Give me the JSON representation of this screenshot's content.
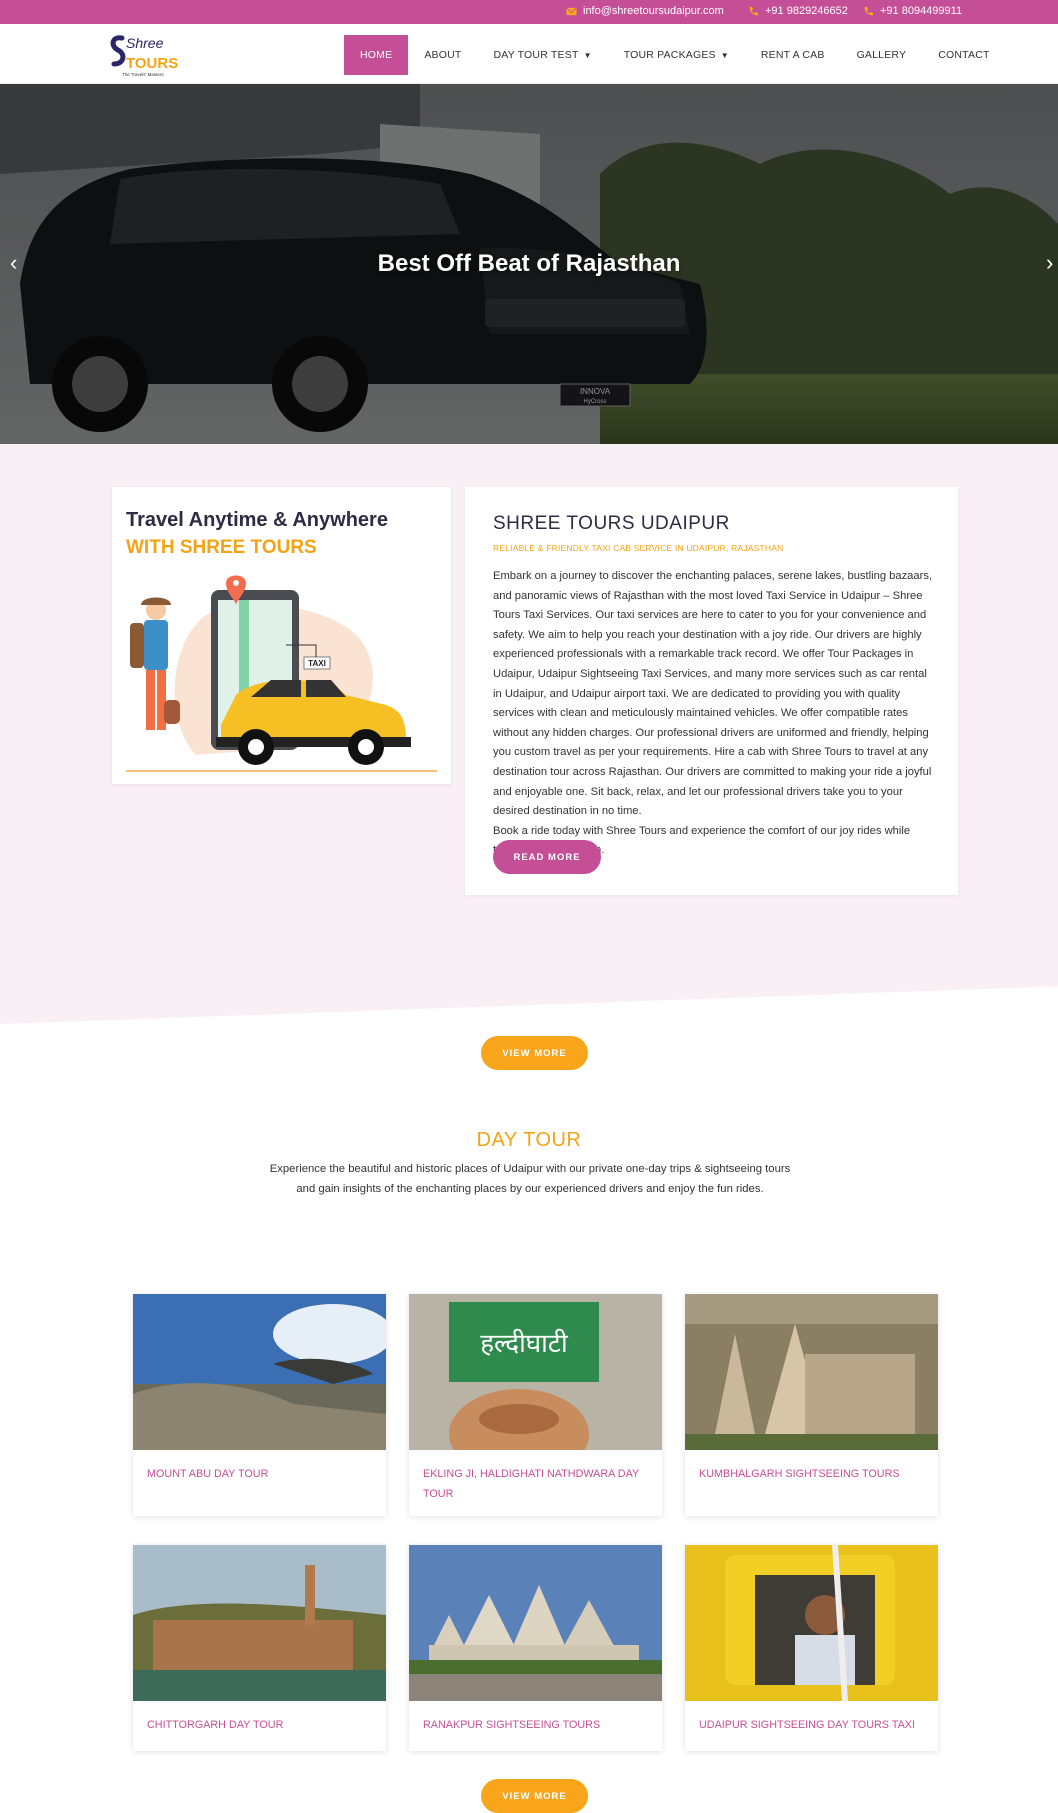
{
  "topbar": {
    "email": "info@shreetoursudaipur.com",
    "phone1": "+91 9829246652",
    "phone2": "+91 8094499911"
  },
  "logo": {
    "brand_top": "Shree",
    "brand_bottom": "TOURS",
    "tagline": "The Travels' Masters"
  },
  "nav": {
    "items": [
      {
        "label": "HOME",
        "active": true
      },
      {
        "label": "ABOUT"
      },
      {
        "label": "DAY TOUR TEST",
        "dropdown": true
      },
      {
        "label": "TOUR PACKAGES",
        "dropdown": true
      },
      {
        "label": "RENT A CAB"
      },
      {
        "label": "GALLERY"
      },
      {
        "label": "CONTACT"
      }
    ]
  },
  "hero": {
    "title": "Best Off Beat of Rajasthan",
    "car_badge_top": "INNOVA",
    "car_badge_bottom": "HyCross"
  },
  "about": {
    "promo_line1": "Travel Anytime & Anywhere",
    "promo_line2": "WITH SHREE TOURS",
    "taxi_sign": "TAXI",
    "title": "SHREE TOURS UDAIPUR",
    "subtitle": "RELIABLE & FRIENDLY TAXI CAB SERVICE IN UDAIPUR, RAJASTHAN",
    "paragraph1": "Embark on a journey to discover the enchanting palaces, serene lakes, bustling bazaars, and panoramic views of Rajasthan with the most loved Taxi Service in Udaipur – Shree Tours Taxi Services. Our taxi services are here to cater to you for your convenience and safety. We aim to help you reach your destination with a joy ride. Our drivers are highly experienced professionals with a remarkable track record. We offer Tour Packages in Udaipur, Udaipur Sightseeing Taxi Services, and many more services such as car rental in Udaipur, and Udaipur airport taxi. We are dedicated to providing you with quality services with clean and meticulously maintained vehicles. We offer compatible rates without any hidden charges. Our professional drivers are uniformed and friendly, helping you custom travel as per your requirements. Hire a cab with Shree Tours to travel at any destination tour across Rajasthan. Our drivers are committed to making your ride a joyful and enjoyable one. Sit back, relax, and let our professional drivers take you to your desired destination in no time.",
    "paragraph2": "Book a ride today with Shree Tours and experience the comfort of our joy rides while traveling to Rajasthan.",
    "read_more": "READ MORE"
  },
  "view_more": "VIEW MORE",
  "daytour": {
    "title": "DAY TOUR",
    "description": "Experience the beautiful and historic places of Udaipur with our private one-day trips & sightseeing tours and gain insights of the enchanting places by our experienced drivers and enjoy the fun rides.",
    "sign_text": "हल्दीघाटी",
    "cards": [
      {
        "title": "MOUNT ABU DAY TOUR"
      },
      {
        "title": "EKLING JI, HALDIGHATI NATHDWARA DAY TOUR"
      },
      {
        "title": "KUMBHALGARH SIGHTSEEING TOURS"
      },
      {
        "title": "CHITTORGARH DAY TOUR"
      },
      {
        "title": "RANAKPUR SIGHTSEEING TOURS"
      },
      {
        "title": "UDAIPUR SIGHTSEEING DAY TOURS TAXI"
      }
    ]
  },
  "colors": {
    "brand_pink": "#c54f96",
    "brand_orange": "#f5a316",
    "navy": "#2c2c45"
  }
}
